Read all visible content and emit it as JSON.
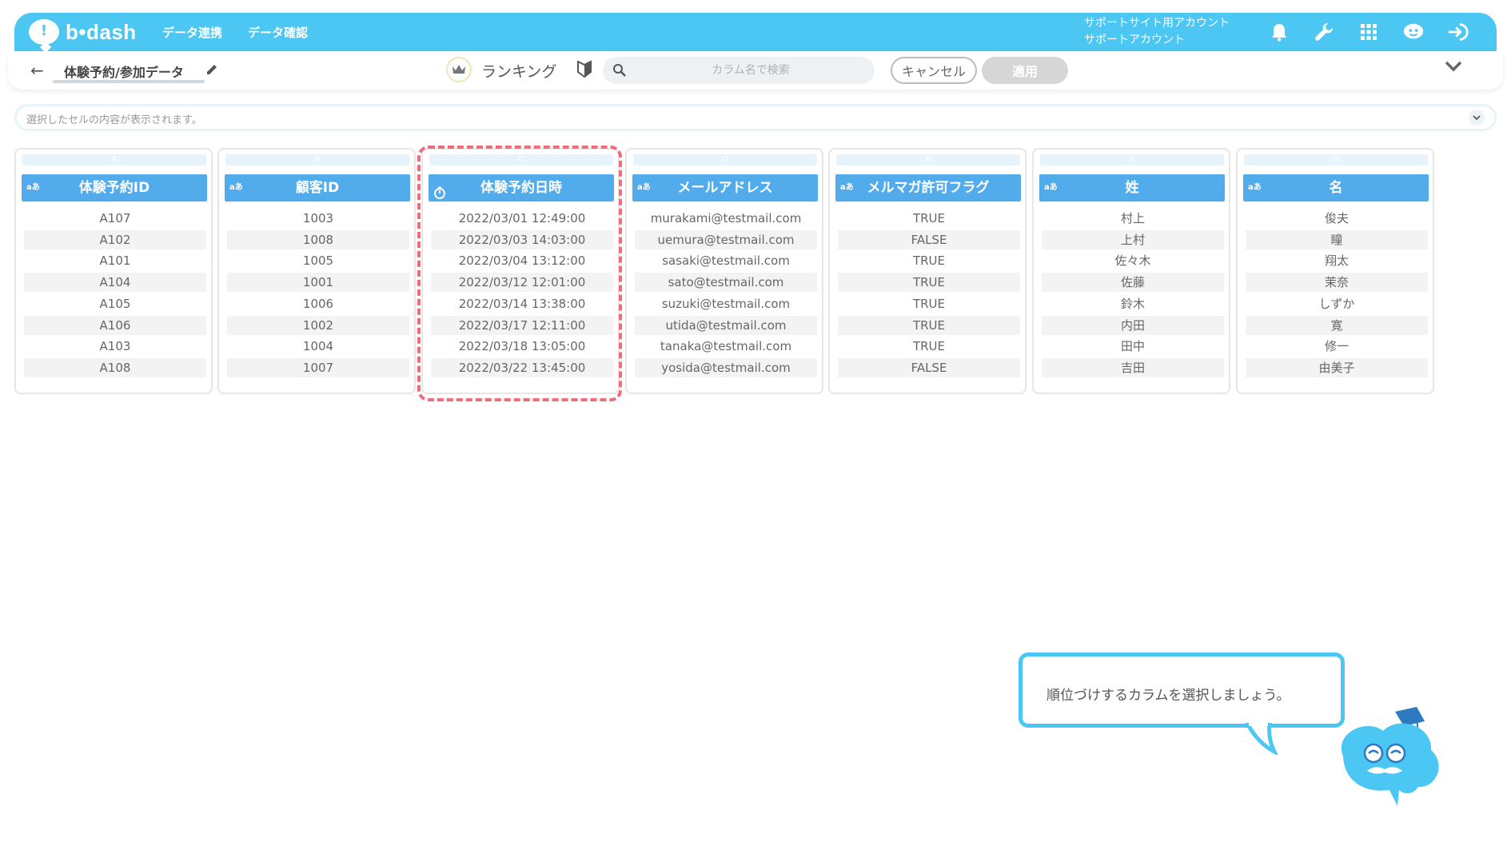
{
  "header": {
    "brand": "b•dash",
    "nav": [
      "データ連携",
      "データ確認"
    ],
    "account_line1": "サポートサイト用アカウント",
    "account_line2": "サポートアカウント",
    "icons": [
      "bell-icon",
      "wrench-icon",
      "grid-icon",
      "support-icon",
      "logout-icon"
    ]
  },
  "toolbar": {
    "table_name": "体験予約/参加データ",
    "mode_label": "ランキング",
    "search_placeholder": "カラム名で検索",
    "cancel_label": "キャンセル",
    "apply_label": "適用"
  },
  "cell_display": {
    "placeholder": "選択したセルの内容が表示されます。"
  },
  "columns": [
    {
      "letter": "A",
      "type": "aあ",
      "name": "体験予約ID",
      "values": [
        "A107",
        "A102",
        "A101",
        "A104",
        "A105",
        "A106",
        "A103",
        "A108"
      ]
    },
    {
      "letter": "B",
      "type": "aあ",
      "name": "顧客ID",
      "values": [
        "1003",
        "1008",
        "1005",
        "1001",
        "1006",
        "1002",
        "1004",
        "1007"
      ]
    },
    {
      "letter": "C",
      "type": "clock",
      "name": "体験予約日時",
      "values": [
        "2022/03/01 12:49:00",
        "2022/03/03 14:03:00",
        "2022/03/04 13:12:00",
        "2022/03/12 12:01:00",
        "2022/03/14 13:38:00",
        "2022/03/17 12:11:00",
        "2022/03/18 13:05:00",
        "2022/03/22 13:45:00"
      ]
    },
    {
      "letter": "D",
      "type": "aあ",
      "name": "メールアドレス",
      "values": [
        "murakami@testmail.com",
        "uemura@testmail.com",
        "sasaki@testmail.com",
        "sato@testmail.com",
        "suzuki@testmail.com",
        "utida@testmail.com",
        "tanaka@testmail.com",
        "yosida@testmail.com"
      ]
    },
    {
      "letter": "E",
      "type": "aあ",
      "name": "メルマガ許可フラグ",
      "values": [
        "TRUE",
        "FALSE",
        "TRUE",
        "TRUE",
        "TRUE",
        "TRUE",
        "TRUE",
        "FALSE"
      ]
    },
    {
      "letter": "F",
      "type": "aあ",
      "name": "姓",
      "values": [
        "村上",
        "上村",
        "佐々木",
        "佐藤",
        "鈴木",
        "内田",
        "田中",
        "吉田"
      ]
    },
    {
      "letter": "G",
      "type": "aあ",
      "name": "名",
      "values": [
        "俊夫",
        "瞳",
        "翔太",
        "茉奈",
        "しずか",
        "寛",
        "修一",
        "由美子"
      ]
    }
  ],
  "tooltip": {
    "text": "順位づけするカラムを選択しましょう。"
  },
  "colors": {
    "header": "#4cc6f3",
    "column_header": "#52abeb",
    "highlight": "#f06b7b"
  }
}
